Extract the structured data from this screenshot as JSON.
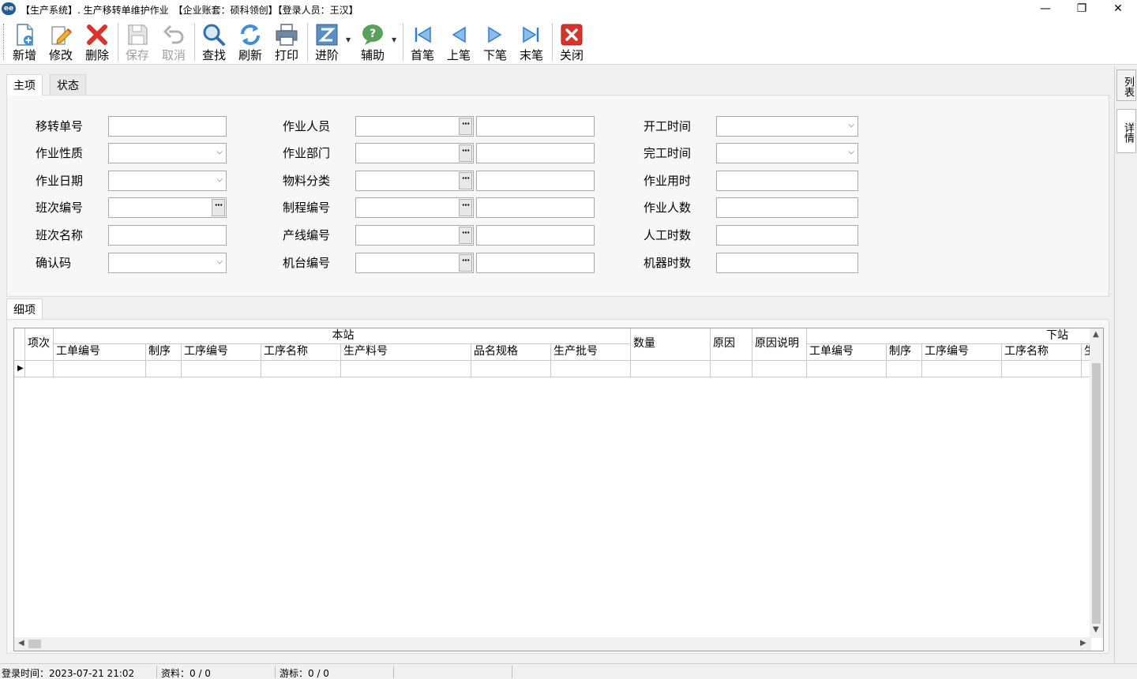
{
  "window": {
    "title": "【生产系统】. 生产移转单维护作业　【企业账套：硕科领创】【登录人员：王汉】",
    "icon_text": "ee",
    "controls": {
      "minimize": "—",
      "restore": "❐",
      "close": "✕"
    }
  },
  "toolbar": {
    "new": "新增",
    "edit": "修改",
    "delete": "删除",
    "save": "保存",
    "cancel": "取消",
    "find": "查找",
    "refresh": "刷新",
    "print": "打印",
    "advanced": "进阶",
    "assist": "辅助",
    "first": "首笔",
    "prev": "上笔",
    "next": "下笔",
    "last": "末笔",
    "close": "关闭",
    "disabled": [
      "保存",
      "取消"
    ]
  },
  "tabs": {
    "main": "主项",
    "status": "状态",
    "detail": "细项"
  },
  "form": {
    "col1": {
      "transfer_no": "移转单号",
      "work_nature": "作业性质",
      "work_date": "作业日期",
      "shift_no": "班次编号",
      "shift_name": "班次名称",
      "confirm_code": "确认码"
    },
    "col2": {
      "operator": "作业人员",
      "department": "作业部门",
      "material_class": "物料分类",
      "process_no": "制程编号",
      "line_no": "产线编号",
      "machine_no": "机台编号"
    },
    "col3": {
      "start_time": "开工时间",
      "finish_time": "完工时间",
      "work_hours": "作业用时",
      "headcount": "作业人数",
      "labor_hours": "人工时数",
      "machine_hours": "机器时数"
    }
  },
  "grid": {
    "group_this": "本站",
    "group_next": "下站",
    "headers": {
      "item_no": "项次",
      "wo_no": "工单编号",
      "process": "制序",
      "op_no": "工序编号",
      "op_name": "工序名称",
      "part_no": "生产料号",
      "spec": "品名规格",
      "batch": "生产批号",
      "qty": "数量",
      "reason": "原因",
      "reason_desc": "原因说明",
      "next_wo_no": "工单编号",
      "next_process": "制序",
      "next_op_no": "工序编号",
      "next_op_name": "工序名称",
      "next_partial": "生"
    }
  },
  "side_tabs": {
    "list": "列表",
    "detail": "详情"
  },
  "statusbar": {
    "login_time": "登录时间：2023-07-21 21:02",
    "records": "资料：0 / 0",
    "cursor": "游标：0 / 0"
  },
  "colors": {
    "delete_red": "#d9342b",
    "close_red": "#c9302c",
    "nav_blue": "#2f7ed8",
    "refresh_blue": "#3f8fd8",
    "assist_green": "#5aa05a"
  }
}
